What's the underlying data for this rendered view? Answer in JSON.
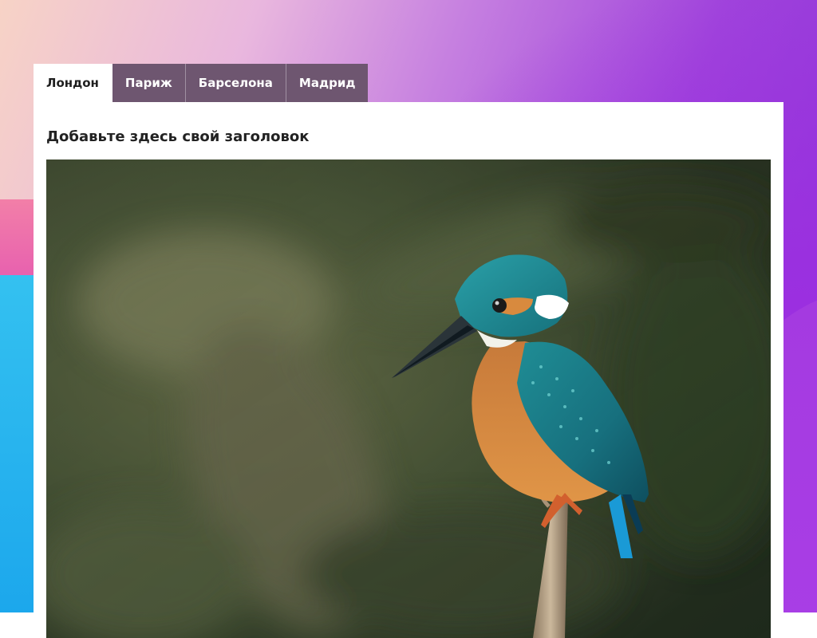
{
  "tabs": [
    {
      "label": "Лондон",
      "active": true
    },
    {
      "label": "Париж",
      "active": false
    },
    {
      "label": "Барселона",
      "active": false
    },
    {
      "label": "Мадрид",
      "active": false
    }
  ],
  "panel": {
    "title": "Добавьте здесь свой заголовок",
    "image_subject": "kingfisher-bird-on-branch"
  },
  "colors": {
    "tab_inactive_bg": "#6e5670",
    "tab_active_bg": "#ffffff",
    "panel_bg": "#ffffff",
    "desktop_accent": "#9b2fe0"
  }
}
